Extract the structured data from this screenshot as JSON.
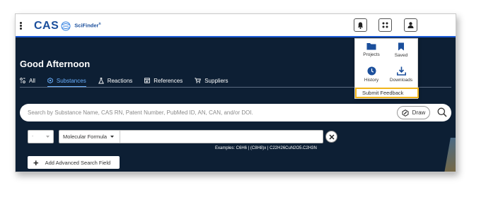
{
  "header": {
    "brand": "CAS",
    "product": "SciFinder",
    "product_mark": "n",
    "icons": [
      "menu-kebab-icon",
      "bell-icon",
      "apps-grid-icon",
      "user-icon"
    ]
  },
  "greeting": "Good Afternoon",
  "tabs": [
    {
      "label": "All",
      "icon": "all-icon",
      "active": false
    },
    {
      "label": "Substances",
      "icon": "substance-icon",
      "active": true
    },
    {
      "label": "Reactions",
      "icon": "flask-icon",
      "active": false
    },
    {
      "label": "References",
      "icon": "document-icon",
      "active": false
    },
    {
      "label": "Suppliers",
      "icon": "cart-icon",
      "active": false
    }
  ],
  "search": {
    "placeholder": "Search by Substance Name, CAS RN, Patent Number, PubMed ID, AN, CAN, and/or DOI.",
    "draw_label": "Draw"
  },
  "filter": {
    "operator_value": "-",
    "field_label": "Molecular Formula",
    "field_value": "",
    "examples": "Examples: C6H6 | (C8H8)x | C22H26CuN2O5.C2H3N"
  },
  "add_field_label": "Add Advanced Search Field",
  "apps_menu": {
    "items": [
      {
        "label": "Projects",
        "icon": "folder-icon"
      },
      {
        "label": "Saved",
        "icon": "bookmark-icon"
      },
      {
        "label": "History",
        "icon": "history-icon"
      },
      {
        "label": "Downloads",
        "icon": "download-icon"
      }
    ],
    "feedback_label": "Submit Feedback"
  },
  "colors": {
    "background": "#0d1f34",
    "accent": "#1b5ad6",
    "active_tab": "#6ab0ff",
    "highlight": "#f0b41a",
    "brand": "#1b4f9c"
  }
}
